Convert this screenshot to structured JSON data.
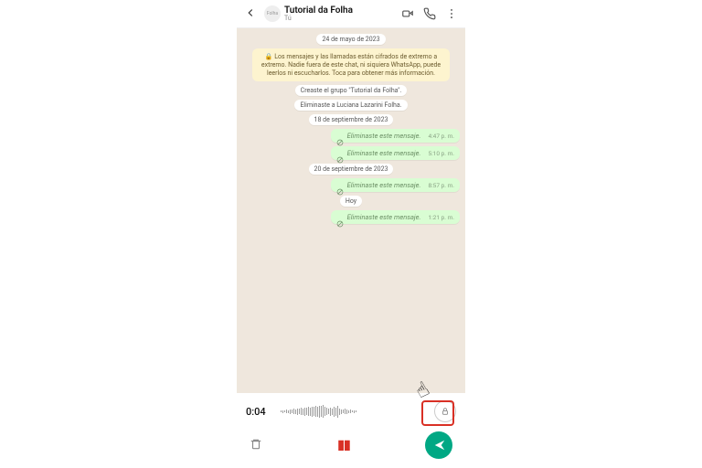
{
  "header": {
    "title": "Tutorial da Folha",
    "subtitle": "Tú",
    "avatar_label": "Folha"
  },
  "dates": {
    "d1": "24 de mayo de 2023",
    "d2": "18 de septiembre de 2023",
    "d3": "20 de septiembre de 2023",
    "d4": "Hoy"
  },
  "encryption_notice": "🔒 Los mensajes y las llamadas están cifrados de extremo a extremo. Nadie fuera de este chat, ni siquiera WhatsApp, puede leerlos ni escucharlos. Toca para obtener más información.",
  "system": {
    "created": "Creaste el grupo \"Tutorial da Folha\".",
    "removed": "Eliminaste a Luciana Lazarini Folha."
  },
  "deleted_label": "Eliminaste este mensaje.",
  "msgs": [
    {
      "ts": "4:47 p. m."
    },
    {
      "ts": "5:10 p. m."
    },
    {
      "ts": "8:57 p. m."
    },
    {
      "ts": "1:21 p. m."
    }
  ],
  "recorder": {
    "elapsed": "0:04"
  }
}
